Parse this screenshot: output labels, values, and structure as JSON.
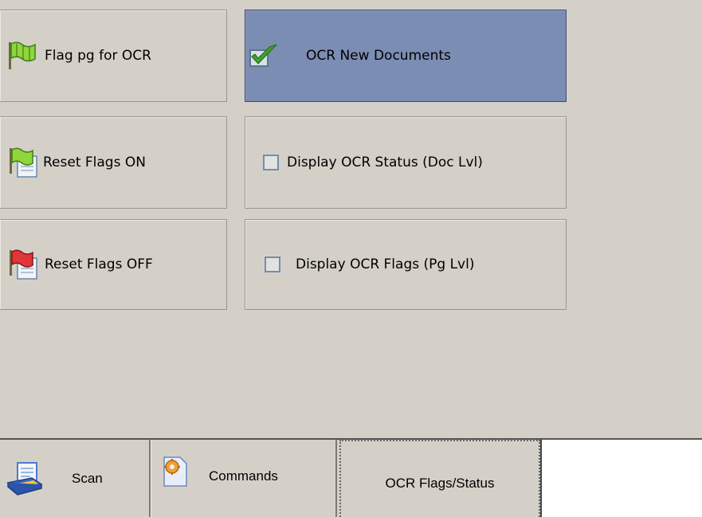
{
  "panel": {
    "buttons": [
      {
        "label": "Flag pg for OCR",
        "icon": "green-flag-icon"
      },
      {
        "label": "OCR New Documents",
        "icon": "green-check-icon",
        "checked": true
      },
      {
        "label": "Reset Flags ON",
        "icon": "green-flag-document-icon"
      },
      {
        "label": "Display OCR Status (Doc Lvl)",
        "icon": "checkbox-icon",
        "checked": false
      },
      {
        "label": "Reset Flags OFF",
        "icon": "red-flag-document-icon"
      },
      {
        "label": "Display OCR Flags (Pg Lvl)",
        "icon": "checkbox-icon",
        "checked": false
      }
    ]
  },
  "tabs": [
    {
      "label": "Scan",
      "icon": "scanner-icon"
    },
    {
      "label": "Commands",
      "icon": "commands-icon"
    },
    {
      "label": "OCR Flags/Status",
      "active": true
    }
  ],
  "colors": {
    "background": "#d4d0c8",
    "checked_button": "#7c8db4",
    "checkbox_border": "#6f8fb0"
  }
}
